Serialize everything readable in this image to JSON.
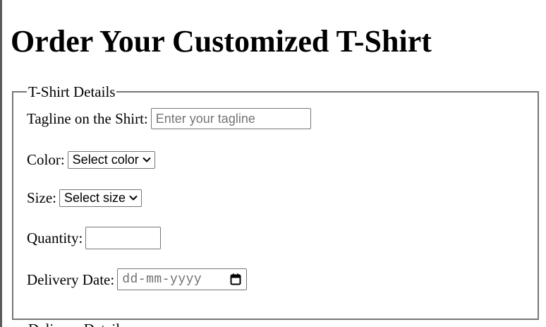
{
  "page": {
    "title": "Order Your Customized T-Shirt"
  },
  "tshirt_details": {
    "legend": "T-Shirt Details",
    "tagline": {
      "label": "Tagline on the Shirt:",
      "placeholder": "Enter your tagline",
      "value": ""
    },
    "color": {
      "label": "Color:",
      "selected": "Select color"
    },
    "size": {
      "label": "Size:",
      "selected": "Select size"
    },
    "quantity": {
      "label": "Quantity:",
      "value": ""
    },
    "delivery_date": {
      "label": "Delivery Date:",
      "placeholder": "dd-mm-yyyy",
      "icon": "calendar-icon"
    }
  },
  "delivery_details": {
    "legend": "Delivery Details"
  }
}
